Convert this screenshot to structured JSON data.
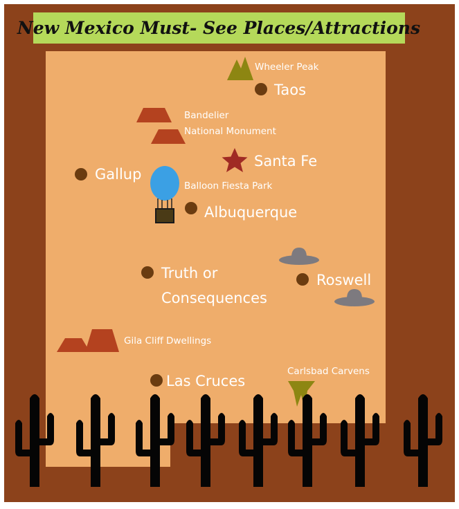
{
  "title": "New Mexico Must- See Places/Attractions",
  "colors": {
    "border": "#8c421b",
    "state_fill": "#efad6b",
    "title_bg": "#b5d95a",
    "city_dot": "#6b3c10",
    "mesa": "#b4421f",
    "mountain": "#8d8612",
    "star": "#a02b24",
    "balloon": "#3ba0e4",
    "ufo": "#7d7a7f",
    "cactus": "#050505"
  },
  "cities": [
    "Taos",
    "Santa Fe",
    "Gallup",
    "Albuquerque",
    "Truth or",
    "Consequences",
    "Roswell",
    "Las Cruces"
  ],
  "attractions": [
    "Wheeler Peak",
    "Bandelier",
    "National Monument",
    "Balloon Fiesta Park",
    "Gila Cliff Dwellings",
    "Carlsbad Carvens"
  ],
  "icons": {
    "mountain": "mountain-icon",
    "mesa": "mesa-icon",
    "star": "capital-star-icon",
    "balloon": "hot-air-balloon-icon",
    "ufo": "ufo-icon",
    "cave": "stalactite-icon",
    "cactus": "saguaro-cactus-icon"
  }
}
